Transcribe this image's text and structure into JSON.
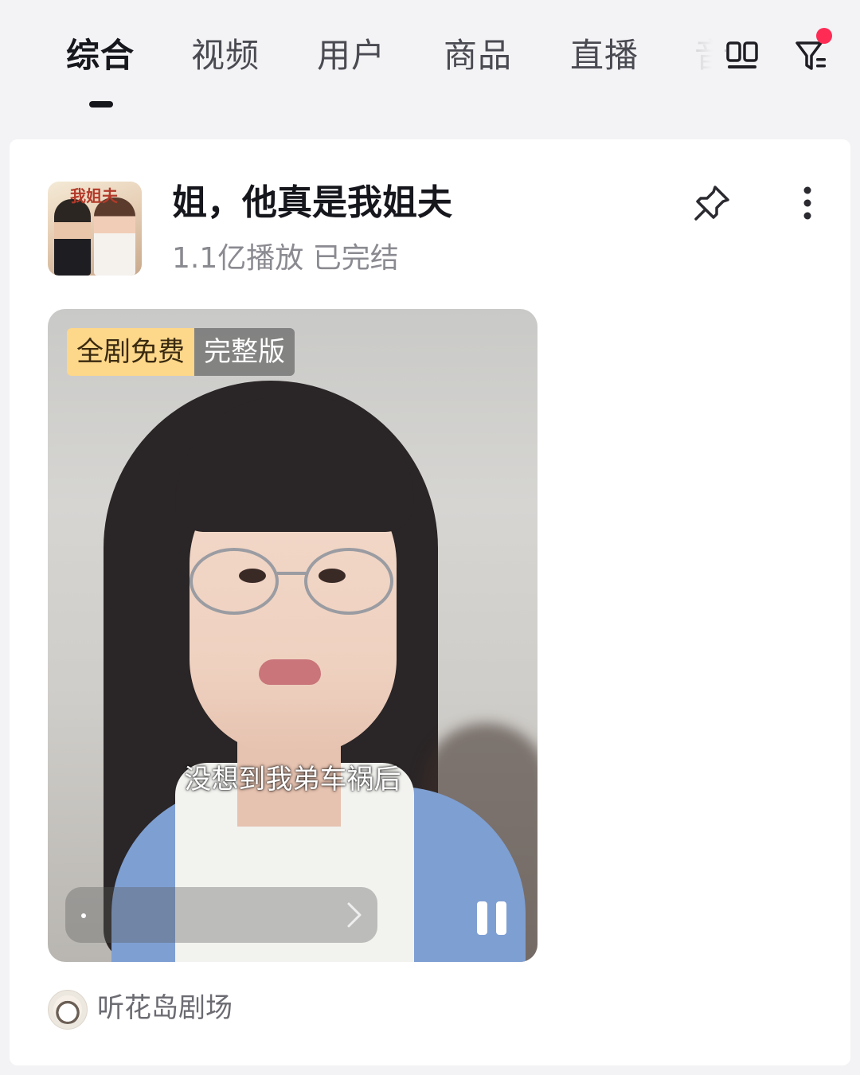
{
  "tabs": [
    {
      "label": "综合",
      "active": true
    },
    {
      "label": "视频",
      "active": false
    },
    {
      "label": "用户",
      "active": false
    },
    {
      "label": "商品",
      "active": false
    },
    {
      "label": "直播",
      "active": false
    },
    {
      "label": "音",
      "active": false
    }
  ],
  "header_icons": {
    "layout_toggle": "dual-column-icon",
    "filter": "filter-icon",
    "filter_has_notification": true
  },
  "result": {
    "title": "姐，他真是我姐夫",
    "meta": "1.1亿播放 已完结",
    "cover_text": "我姐夫",
    "pin_icon": "pin-icon",
    "more_icon": "more-vertical-icon"
  },
  "video": {
    "badge_free": "全剧免费",
    "badge_full": "完整版",
    "subtitle": "没想到我弟车祸后",
    "state": "playing",
    "pause_icon": "pause-icon",
    "chevron_icon": "chevron-right-icon"
  },
  "author": {
    "name": "听花岛剧场",
    "avatar_icon": "author-avatar"
  },
  "colors": {
    "accent": "#fe2c55",
    "badge_free_bg": "#fdd78a",
    "text_primary": "#16161d",
    "text_secondary": "#8a8a91",
    "page_bg": "#f3f3f5"
  }
}
